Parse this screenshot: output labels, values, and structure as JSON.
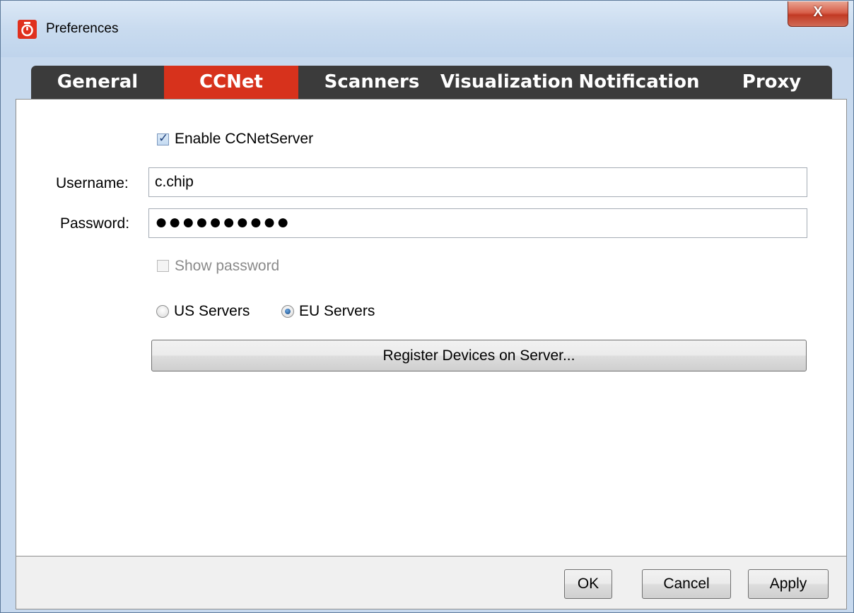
{
  "window": {
    "title": "Preferences",
    "close_label": "X"
  },
  "tabs": [
    {
      "label": "General",
      "active": false
    },
    {
      "label": "CCNet",
      "active": true
    },
    {
      "label": "Scanners",
      "active": false
    },
    {
      "label": "Visualization",
      "active": false
    },
    {
      "label": "Notification",
      "active": false
    },
    {
      "label": "Proxy",
      "active": false
    }
  ],
  "ccnet": {
    "enable_label": "Enable CCNetServer",
    "enable_checked": true,
    "username_label": "Username:",
    "username_value": "c.chip",
    "password_label": "Password:",
    "password_masked": "●●●●●●●●●●",
    "show_password_label": "Show password",
    "show_password_checked": false,
    "servers": [
      {
        "label": "US Servers",
        "selected": false
      },
      {
        "label": "EU Servers",
        "selected": true
      }
    ],
    "register_button": "Register Devices on Server..."
  },
  "footer": {
    "ok": "OK",
    "cancel": "Cancel",
    "apply": "Apply"
  },
  "colors": {
    "active_tab": "#d7321c",
    "tab_bar": "#3b3b3b"
  }
}
